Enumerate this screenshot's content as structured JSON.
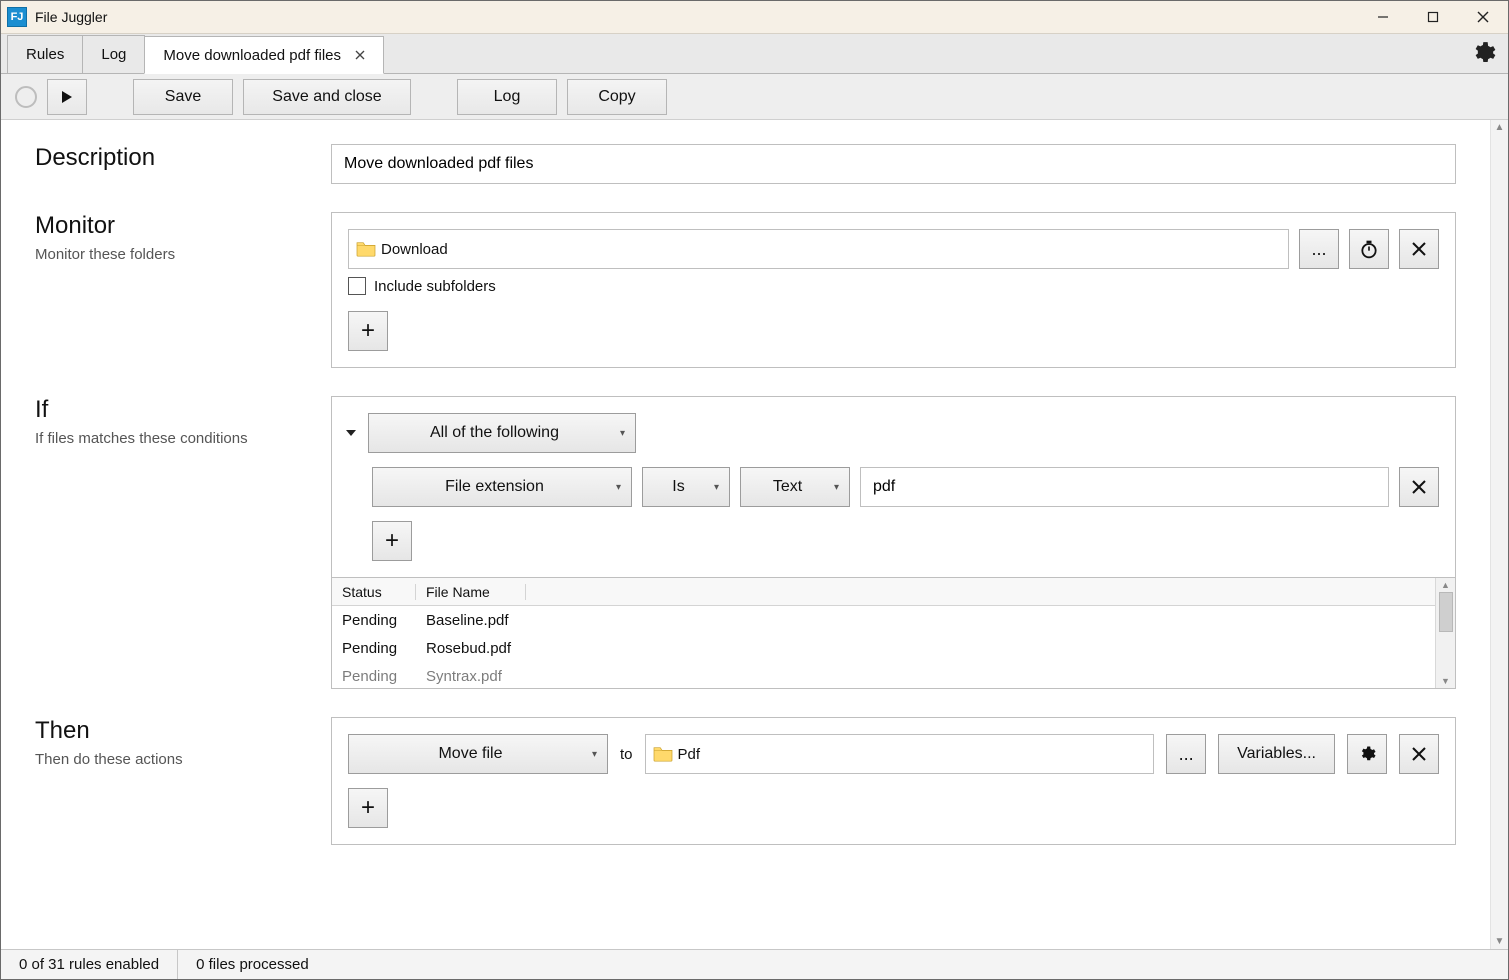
{
  "window": {
    "title": "File Juggler"
  },
  "tabs": {
    "rules": "Rules",
    "log": "Log",
    "active": "Move downloaded pdf files"
  },
  "toolbar": {
    "save": "Save",
    "save_close": "Save and close",
    "log": "Log",
    "copy": "Copy"
  },
  "description": {
    "heading": "Description",
    "value": "Move downloaded pdf files"
  },
  "monitor": {
    "heading": "Monitor",
    "sub": "Monitor these folders",
    "folder": "Download",
    "browse": "...",
    "include_sub": "Include subfolders"
  },
  "ifblock": {
    "heading": "If",
    "sub": "If files matches these conditions",
    "match_mode": "All of the following",
    "cond_field": "File extension",
    "cond_op": "Is",
    "cond_type": "Text",
    "cond_value": "pdf"
  },
  "filelist": {
    "col_status": "Status",
    "col_fname": "File Name",
    "rows": [
      {
        "status": "Pending",
        "fname": "Baseline.pdf"
      },
      {
        "status": "Pending",
        "fname": "Rosebud.pdf"
      },
      {
        "status": "Pending",
        "fname": "Syntrax.pdf"
      }
    ]
  },
  "thenblock": {
    "heading": "Then",
    "sub": "Then do these actions",
    "action": "Move file",
    "to": "to",
    "dest": "Pdf",
    "browse": "...",
    "variables": "Variables..."
  },
  "status": {
    "rules": "0 of 31 rules enabled",
    "files": "0 files processed"
  }
}
